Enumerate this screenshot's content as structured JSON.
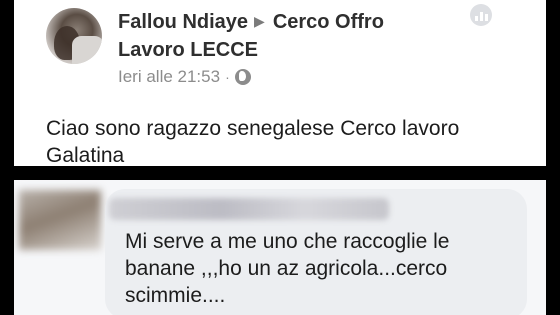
{
  "post": {
    "author": "Fallou Ndiaye",
    "group_prefix": "Cerco Offro",
    "group_suffix": "Lavoro LECCE",
    "timestamp": "Ieri alle 21:53",
    "separator": "·",
    "body": "Ciao sono ragazzo senegalese Cerco lavoro Galatina",
    "privacy_icon": "globe-icon",
    "menu_icon": "stats-icon"
  },
  "comment": {
    "text": "Mi serve a me uno che raccoglie le banane ,,,ho un az agricola...cerco scimmie...."
  },
  "colors": {
    "background": "#000000",
    "card": "#ffffff",
    "bubble": "#eceef1",
    "meta_text": "#8c8c8c"
  }
}
